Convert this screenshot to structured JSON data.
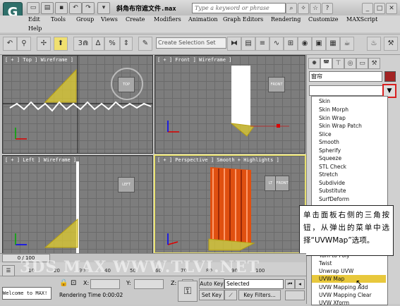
{
  "window": {
    "title": "斜角布帘遮文件.max",
    "search_placeholder": "Type a keyword or phrase"
  },
  "menu": [
    "Edit",
    "Tools",
    "Group",
    "Views",
    "Create",
    "Modifiers",
    "Animation",
    "Graph Editors",
    "Rendering",
    "Customize",
    "MAXScript",
    "Help"
  ],
  "toolbar": {
    "selection_set_placeholder": "Create Selection Set",
    "snap_label": "3",
    "angle_snap_label": "∆",
    "percent_snap_label": "%"
  },
  "viewports": {
    "top": {
      "label": "[ + ] Top ] Wireframe ]",
      "cube_label": "TOP"
    },
    "front": {
      "label": "[ + ] Front ] Wireframe ]",
      "cube_label": "FRONT"
    },
    "left": {
      "label": "[ + ] Left ] Wireframe ]",
      "cube_label": "LEFT"
    },
    "perspective": {
      "label": "[ + ] Perspective ] Smooth + Highlights ]",
      "cube_left": "LT",
      "cube_right": "FRONT"
    }
  },
  "command_panel": {
    "object_name": "窗帘",
    "object_color": "#a32424",
    "modifier_list": [
      "Skin",
      "Skin Morph",
      "Skin Wrap",
      "Skin Wrap Patch",
      "Slice",
      "Smooth",
      "Spherify",
      "Squeeze",
      "STL Check",
      "Stretch",
      "Subdivide",
      "Substitute",
      "SurfDeform",
      "Turn to Poly",
      "Twist",
      "Unwrap UVW",
      "UVW Map",
      "UVW Mapping Add",
      "UVW Mapping Clear",
      "UVW Xform"
    ],
    "highlighted_item": "UVW Map"
  },
  "callout": {
    "text": "单击面板右侧的三角按钮，从弹出的菜单中选择“UVWMap”选项。"
  },
  "timeline": {
    "frame_display": "0 / 100",
    "ticks": [
      "10",
      "20",
      "30",
      "40",
      "50",
      "60",
      "70",
      "80",
      "90",
      "100"
    ]
  },
  "status": {
    "listener_text": "Welcome to MAX!",
    "x_label": "X:",
    "y_label": "Y:",
    "z_label": "Z:",
    "auto_key": "Auto Key",
    "set_key": "Set Key",
    "selected_option": "Selected",
    "key_filters": "Key Filters...",
    "rendering_time": "Rendering Time  0:00:02"
  },
  "watermark": "3DS MAX WWW.TLVI.NET",
  "colors": {
    "accent_red": "#d82020",
    "highlight": "#e8c83c",
    "curtain": "#e05010"
  }
}
